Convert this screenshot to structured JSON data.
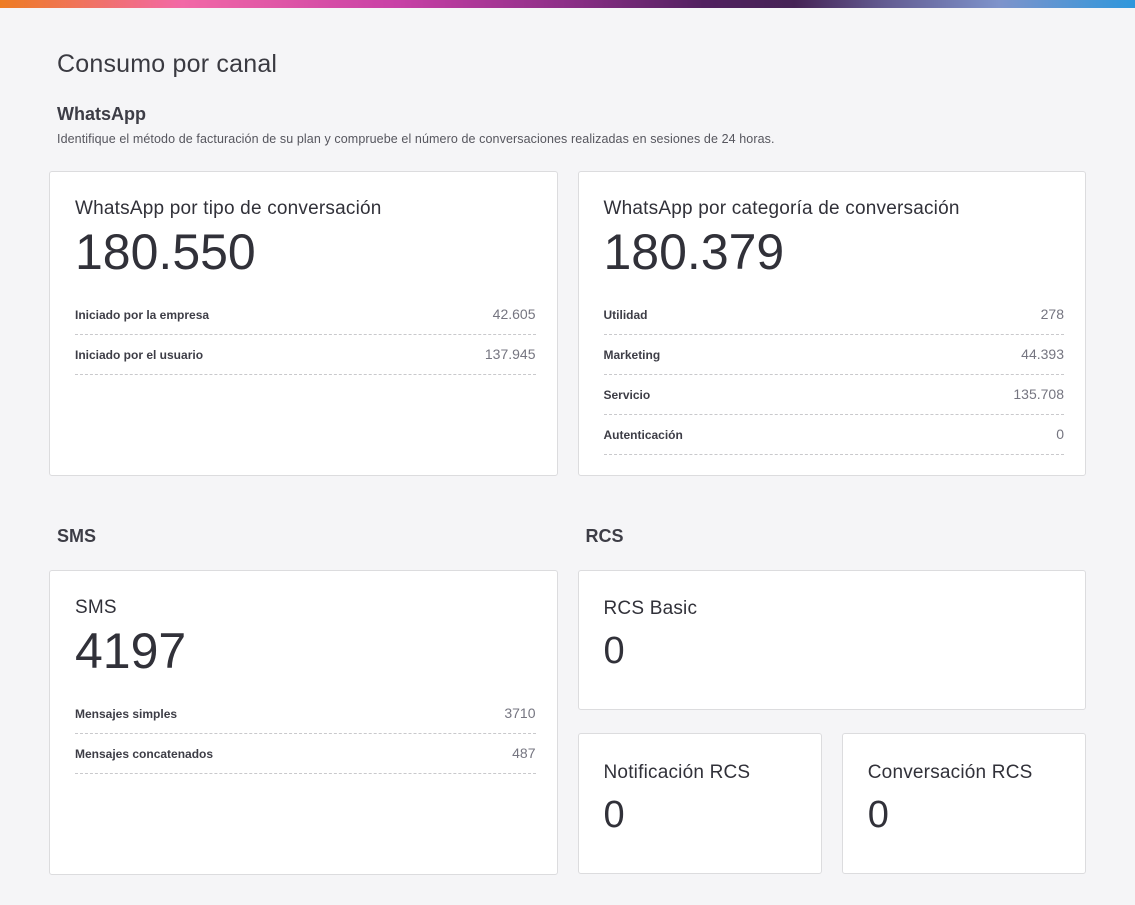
{
  "page": {
    "title": "Consumo por canal"
  },
  "colors": {
    "top_gradient": [
      "#ee7c22",
      "#f268a6",
      "#c840a6",
      "#522160",
      "#635c92",
      "#7e93cb",
      "#2e97dc"
    ],
    "background": "#f5f5f7",
    "card_border": "#dcdcde",
    "text_dark": "#313139",
    "text_muted": "#757580"
  },
  "whatsapp_section": {
    "heading": "WhatsApp",
    "description": "Identifique el método de facturación de su plan y compruebe el número de conversaciones realizadas en sesiones de 24 horas.",
    "cards": [
      {
        "title": "WhatsApp por tipo de conversación",
        "total": "180.550",
        "rows": [
          {
            "label": "Iniciado por la empresa",
            "value": "42.605"
          },
          {
            "label": "Iniciado por el usuario",
            "value": "137.945"
          }
        ]
      },
      {
        "title": "WhatsApp por categoría de conversación",
        "total": "180.379",
        "rows": [
          {
            "label": "Utilidad",
            "value": "278"
          },
          {
            "label": "Marketing",
            "value": "44.393"
          },
          {
            "label": "Servicio",
            "value": "135.708"
          },
          {
            "label": "Autenticación",
            "value": "0"
          }
        ]
      }
    ]
  },
  "sms_section": {
    "heading": "SMS",
    "card": {
      "title": "SMS",
      "total": "4197",
      "rows": [
        {
          "label": "Mensajes simples",
          "value": "3710"
        },
        {
          "label": "Mensajes concatenados",
          "value": "487"
        }
      ]
    }
  },
  "rcs_section": {
    "heading": "RCS",
    "basic_card": {
      "title": "RCS Basic",
      "total": "0"
    },
    "mini_cards": [
      {
        "title": "Notificación RCS",
        "total": "0"
      },
      {
        "title": "Conversación RCS",
        "total": "0"
      }
    ]
  }
}
